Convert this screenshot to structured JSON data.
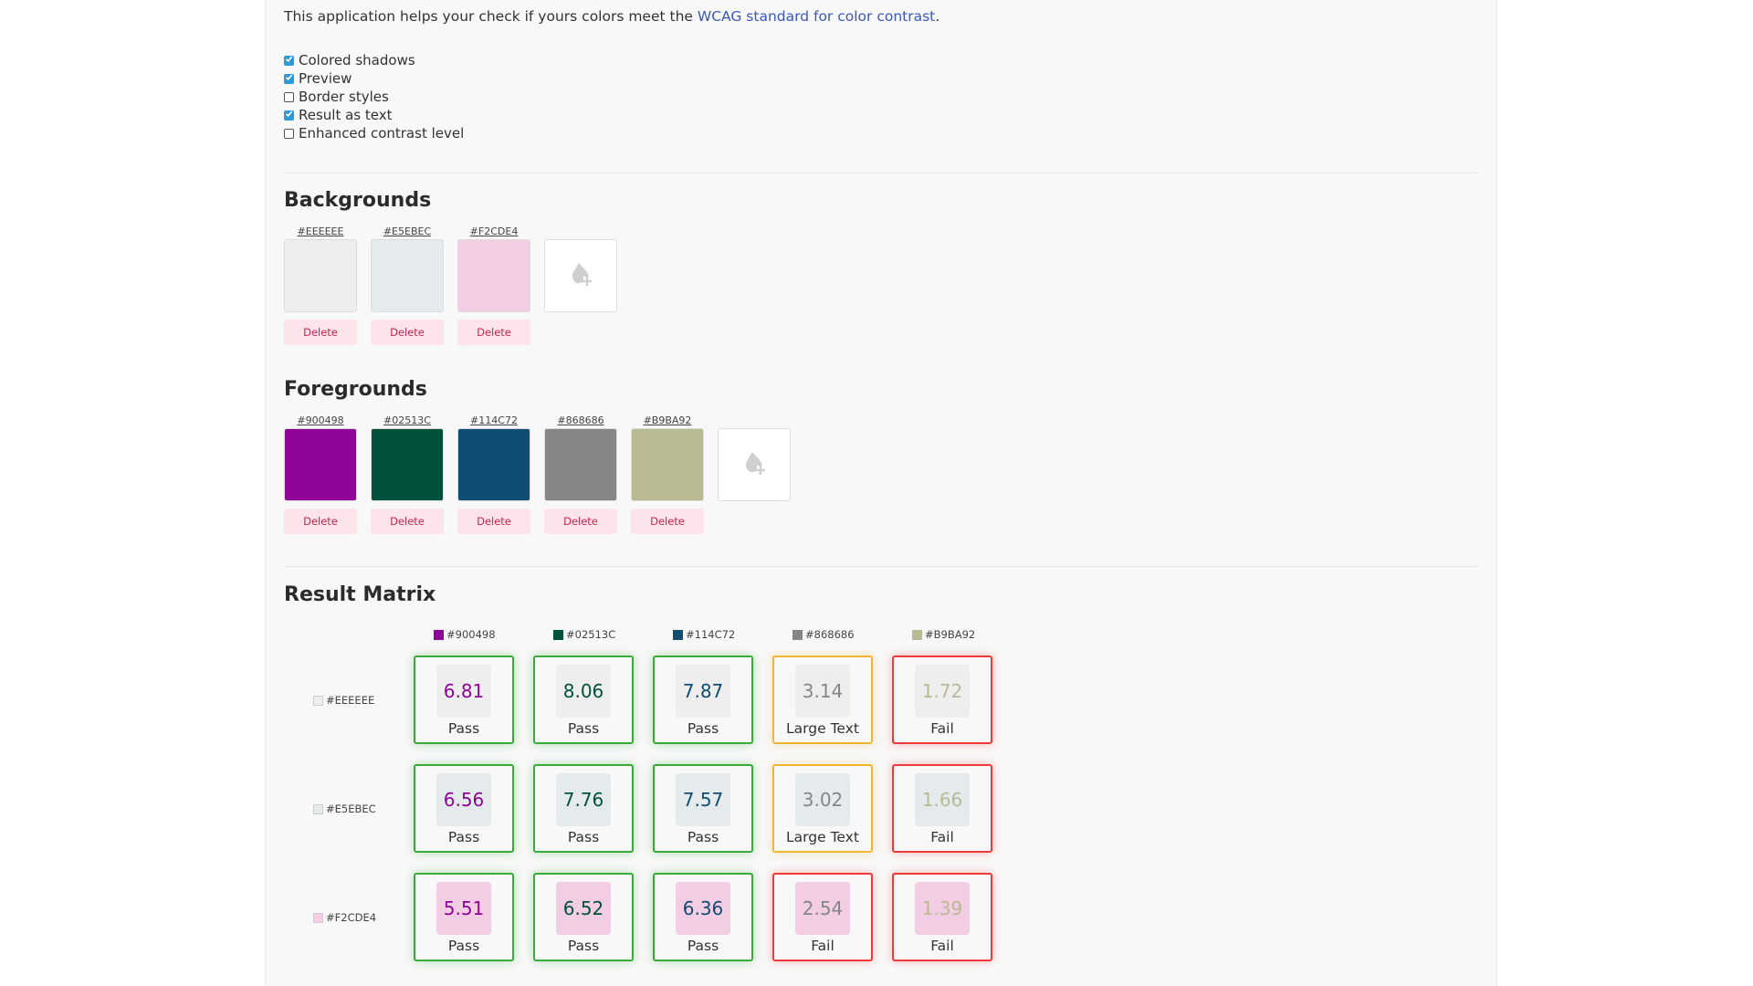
{
  "intro": {
    "text_before": "This application helps your check if yours colors meet the ",
    "link": "WCAG standard for color contrast",
    "text_after": "."
  },
  "options": [
    {
      "label": "Colored shadows",
      "checked": true
    },
    {
      "label": "Preview",
      "checked": true
    },
    {
      "label": "Border styles",
      "checked": false
    },
    {
      "label": "Result as text",
      "checked": true
    },
    {
      "label": "Enhanced contrast level",
      "checked": false
    }
  ],
  "backgrounds": {
    "title": "Backgrounds",
    "delete_label": "Delete",
    "items": [
      {
        "hex": "#EEEEEE",
        "color": "#EEEEEE"
      },
      {
        "hex": "#E5EBEC",
        "color": "#E5EBEC"
      },
      {
        "hex": "#F2CDE4",
        "color": "#F2CDE4"
      }
    ]
  },
  "foregrounds": {
    "title": "Foregrounds",
    "delete_label": "Delete",
    "items": [
      {
        "hex": "#900498",
        "color": "#900498"
      },
      {
        "hex": "#02513C",
        "color": "#02513C"
      },
      {
        "hex": "#114C72",
        "color": "#114C72"
      },
      {
        "hex": "#868686",
        "color": "#868686"
      },
      {
        "hex": "#B9BA92",
        "color": "#B9BA92"
      }
    ]
  },
  "matrix": {
    "title": "Result Matrix",
    "columns": [
      "#900498",
      "#02513C",
      "#114C72",
      "#868686",
      "#B9BA92"
    ],
    "rows": [
      {
        "bg": "#EEEEEE",
        "cells": [
          {
            "value": "6.81",
            "result": "Pass",
            "status": "pass"
          },
          {
            "value": "8.06",
            "result": "Pass",
            "status": "pass"
          },
          {
            "value": "7.87",
            "result": "Pass",
            "status": "pass"
          },
          {
            "value": "3.14",
            "result": "Large Text",
            "status": "large"
          },
          {
            "value": "1.72",
            "result": "Fail",
            "status": "fail"
          }
        ]
      },
      {
        "bg": "#E5EBEC",
        "cells": [
          {
            "value": "6.56",
            "result": "Pass",
            "status": "pass"
          },
          {
            "value": "7.76",
            "result": "Pass",
            "status": "pass"
          },
          {
            "value": "7.57",
            "result": "Pass",
            "status": "pass"
          },
          {
            "value": "3.02",
            "result": "Large Text",
            "status": "large"
          },
          {
            "value": "1.66",
            "result": "Fail",
            "status": "fail"
          }
        ]
      },
      {
        "bg": "#F2CDE4",
        "cells": [
          {
            "value": "5.51",
            "result": "Pass",
            "status": "pass"
          },
          {
            "value": "6.52",
            "result": "Pass",
            "status": "pass"
          },
          {
            "value": "6.36",
            "result": "Pass",
            "status": "pass"
          },
          {
            "value": "2.54",
            "result": "Fail",
            "status": "fail"
          },
          {
            "value": "1.39",
            "result": "Fail",
            "status": "fail"
          }
        ]
      }
    ]
  },
  "icons": {
    "add_color": "droplet-plus-icon",
    "checkbox": "checkmark-icon"
  }
}
